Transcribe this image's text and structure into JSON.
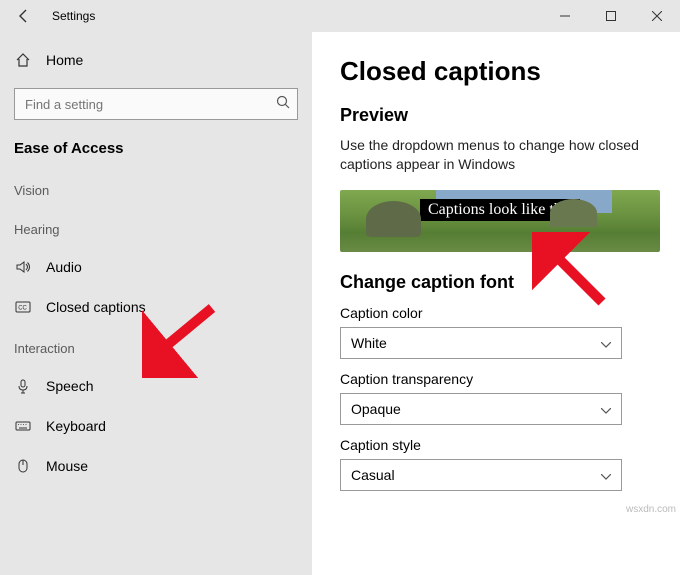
{
  "titlebar": {
    "title": "Settings"
  },
  "sidebar": {
    "home": "Home",
    "search_placeholder": "Find a setting",
    "section": "Ease of Access",
    "groups": {
      "vision": {
        "label": "Vision"
      },
      "hearing": {
        "label": "Hearing",
        "items": [
          {
            "id": "audio",
            "label": "Audio"
          },
          {
            "id": "closed-captions",
            "label": "Closed captions"
          }
        ]
      },
      "interaction": {
        "label": "Interaction",
        "items": [
          {
            "id": "speech",
            "label": "Speech"
          },
          {
            "id": "keyboard",
            "label": "Keyboard"
          },
          {
            "id": "mouse",
            "label": "Mouse"
          }
        ]
      }
    }
  },
  "content": {
    "title": "Closed captions",
    "preview_heading": "Preview",
    "description": "Use the dropdown menus to change how closed captions appear in Windows",
    "caption_sample": "Captions look like this",
    "font_heading": "Change caption font",
    "fields": {
      "color": {
        "label": "Caption color",
        "value": "White"
      },
      "transparency": {
        "label": "Caption transparency",
        "value": "Opaque"
      },
      "style": {
        "label": "Caption style",
        "value": "Casual"
      }
    }
  },
  "watermark": "wsxdn.com"
}
